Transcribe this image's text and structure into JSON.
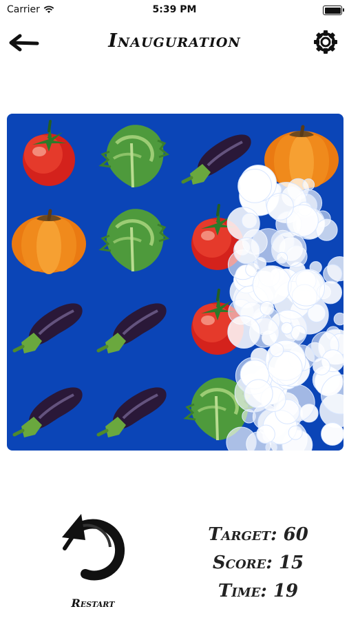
{
  "status_bar": {
    "carrier": "Carrier",
    "time": "5:39 PM",
    "battery_level": 1.0
  },
  "header": {
    "back_icon": "arrow-left-icon",
    "title": "Inauguration",
    "settings_icon": "gear-icon"
  },
  "board": {
    "rows": 4,
    "columns": 4,
    "background": "#0b45b7",
    "cells": [
      [
        "tomato",
        "lettuce",
        "eggplant",
        "pumpkin"
      ],
      [
        "pumpkin",
        "lettuce",
        "tomato",
        "foam"
      ],
      [
        "eggplant",
        "eggplant",
        "tomato",
        "foam"
      ],
      [
        "eggplant",
        "eggplant",
        "lettuce",
        "foam"
      ]
    ]
  },
  "restart": {
    "icon": "restart-icon",
    "label": "Restart"
  },
  "stats": {
    "target": "Target: 60",
    "score": "Score: 15",
    "time": "Time: 19"
  }
}
